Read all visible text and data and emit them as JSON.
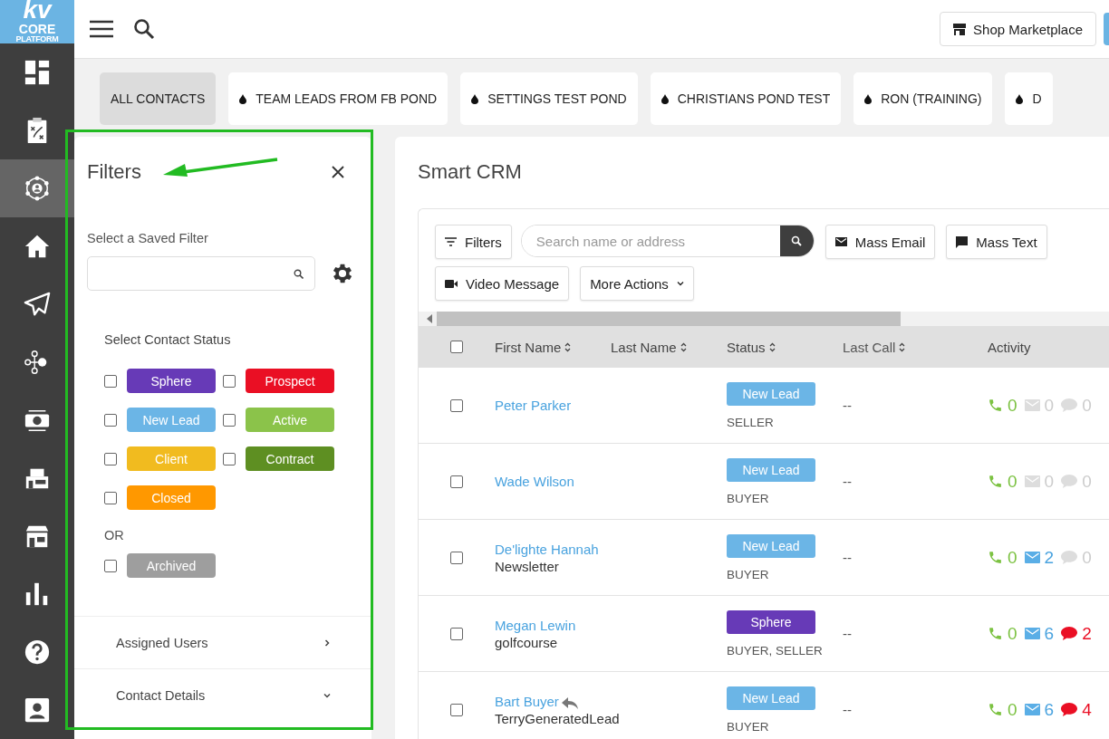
{
  "sidebar": {
    "logo": {
      "top": "kv",
      "middle": "CORE",
      "bottom": "PLATFORM"
    },
    "items": [
      {
        "selected": false
      },
      {
        "selected": false
      },
      {
        "selected": true
      },
      {
        "selected": false
      },
      {
        "selected": false
      },
      {
        "selected": false
      },
      {
        "selected": false
      },
      {
        "selected": false
      },
      {
        "selected": false
      },
      {
        "selected": false
      },
      {
        "selected": false
      },
      {
        "selected": false
      }
    ]
  },
  "topbar": {
    "marketplace_button": "Shop Marketplace"
  },
  "pond_tabs": [
    {
      "label": "ALL CONTACTS",
      "selected": true,
      "kind": "all"
    },
    {
      "label": "TEAM LEADS FROM FB POND",
      "selected": false,
      "kind": "pond"
    },
    {
      "label": "SETTINGS TEST POND",
      "selected": false,
      "kind": "pond"
    },
    {
      "label": "CHRISTIANS POND TEST",
      "selected": false,
      "kind": "pond"
    },
    {
      "label": "RON (TRAINING)",
      "selected": false,
      "kind": "pond"
    },
    {
      "label": "D",
      "selected": false,
      "kind": "pond"
    }
  ],
  "filters": {
    "title": "Filters",
    "saved_filter_label": "Select a Saved Filter",
    "status_label": "Select Contact Status",
    "statuses": [
      {
        "label": "Sphere",
        "color": "#673ab7",
        "checked": false
      },
      {
        "label": "Prospect",
        "color": "#ea0f24",
        "checked": false
      },
      {
        "label": "New Lead",
        "color": "#6bb5e6",
        "checked": false
      },
      {
        "label": "Active",
        "color": "#8bc34a",
        "checked": false
      },
      {
        "label": "Client",
        "color": "#f1bb1f",
        "checked": false
      },
      {
        "label": "Contract",
        "color": "#5e8f22",
        "checked": false
      },
      {
        "label": "Closed",
        "color": "#ff9800",
        "checked": false
      }
    ],
    "or_label": "OR",
    "archived": {
      "label": "Archived",
      "color": "#9e9e9e",
      "checked": false
    },
    "sections": [
      {
        "label": "Assigned Users",
        "expanded": false
      },
      {
        "label": "Contact Details",
        "expanded": true
      }
    ]
  },
  "crm": {
    "title": "Smart CRM",
    "toolbar": {
      "filters_button": "Filters",
      "search_placeholder": "Search name or address",
      "mass_email_button": "Mass Email",
      "mass_text_button": "Mass Text",
      "video_message_button": "Video Message",
      "more_actions_button": "More Actions"
    },
    "select_all_checked": false,
    "columns": [
      {
        "label": "First Name",
        "sortable": true
      },
      {
        "label": "Last Name",
        "sortable": true
      },
      {
        "label": "Status",
        "sortable": true
      },
      {
        "label": "Last Call",
        "sortable": true
      },
      {
        "label": "Activity",
        "sortable": false
      }
    ],
    "rows": [
      {
        "checked": false,
        "name": "Peter Parker",
        "replied": false,
        "status": "New Lead",
        "color": "#6bb5e6",
        "type": "SELLER",
        "last_call": "--",
        "calls": "0",
        "emails": "0",
        "emails_active": false,
        "texts": "0",
        "texts_active": false
      },
      {
        "checked": false,
        "name": "Wade Wilson",
        "replied": false,
        "status": "New Lead",
        "color": "#6bb5e6",
        "type": "BUYER",
        "last_call": "--",
        "calls": "0",
        "emails": "0",
        "emails_active": false,
        "texts": "0",
        "texts_active": false
      },
      {
        "checked": false,
        "name": "De'lighte Hannah",
        "subtitle": "Newsletter",
        "replied": false,
        "status": "New Lead",
        "color": "#6bb5e6",
        "type": "BUYER",
        "last_call": "--",
        "calls": "0",
        "emails": "2",
        "emails_active": true,
        "texts": "0",
        "texts_active": false
      },
      {
        "checked": false,
        "name": "Megan Lewin",
        "subtitle": "golfcourse",
        "replied": false,
        "status": "Sphere",
        "color": "#673ab7",
        "type": "BUYER, SELLER",
        "last_call": "--",
        "calls": "0",
        "emails": "6",
        "emails_active": true,
        "texts": "2",
        "texts_active": true
      },
      {
        "checked": false,
        "name": "Bart Buyer",
        "subtitle": "TerryGeneratedLead",
        "replied": true,
        "status": "New Lead",
        "color": "#6bb5e6",
        "type": "BUYER",
        "last_call": "--",
        "calls": "0",
        "emails": "6",
        "emails_active": true,
        "texts": "4",
        "texts_active": true
      }
    ]
  }
}
